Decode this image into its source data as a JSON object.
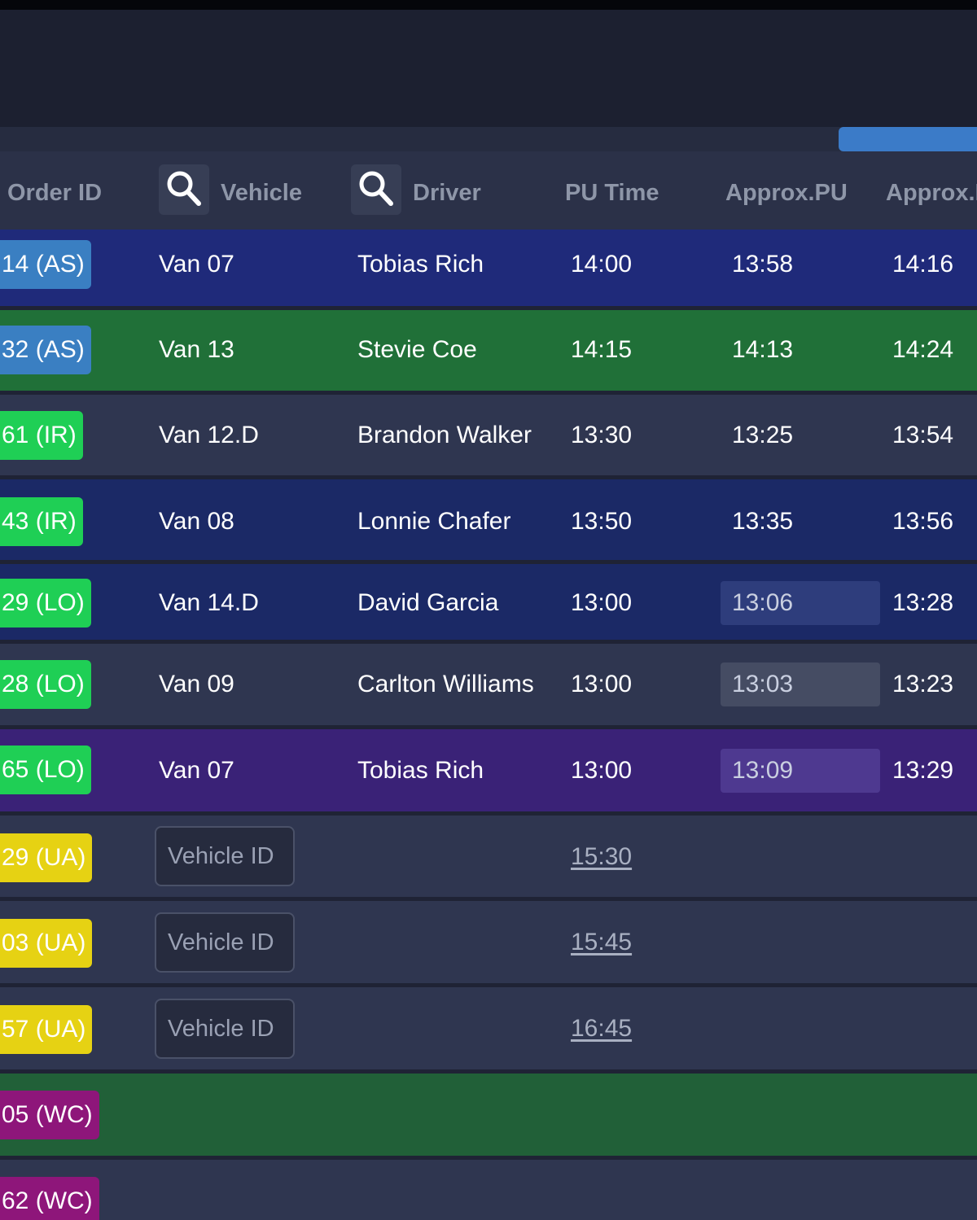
{
  "colors": {
    "row_navy": "#1f2a7a",
    "row_green": "#207038",
    "row_slate": "#2f3650",
    "row_darkblue": "#1b2966",
    "row_purple": "#3a2277",
    "badge_as": "#3a7fc2",
    "badge_ir": "#1fcf55",
    "badge_lo": "#1fcf55",
    "badge_ua": "#e6d213",
    "badge_wc": "#8e167a"
  },
  "header": {
    "order_id": "Order ID",
    "vehicle": "Vehicle",
    "driver": "Driver",
    "pu_time": "PU Time",
    "approx_pu": "Approx.PU",
    "approx_next": "Approx.I",
    "search_icon": "search-icon"
  },
  "rows": [
    {
      "order": "14 (AS)",
      "vehicle": "Van 07",
      "driver": "Tobias Rich",
      "pu_time": "14:00",
      "approx_pu": "13:58",
      "approx_next": "14:16"
    },
    {
      "order": "32 (AS)",
      "vehicle": "Van 13",
      "driver": "Stevie Coe",
      "pu_time": "14:15",
      "approx_pu": "14:13",
      "approx_next": "14:24"
    },
    {
      "order": "61 (IR)",
      "vehicle": "Van 12.D",
      "driver": "Brandon Walker",
      "pu_time": "13:30",
      "approx_pu": "13:25",
      "approx_next": "13:54"
    },
    {
      "order": "43 (IR)",
      "vehicle": "Van 08",
      "driver": "Lonnie Chafer",
      "pu_time": "13:50",
      "approx_pu": "13:35",
      "approx_next": "13:56"
    },
    {
      "order": "29 (LO)",
      "vehicle": "Van 14.D",
      "driver": "David Garcia",
      "pu_time": "13:00",
      "approx_pu": "13:06",
      "approx_next": "13:28"
    },
    {
      "order": "28 (LO)",
      "vehicle": "Van 09",
      "driver": "Carlton Williams",
      "pu_time": "13:00",
      "approx_pu": "13:03",
      "approx_next": "13:23"
    },
    {
      "order": "65 (LO)",
      "vehicle": "Van 07",
      "driver": "Tobias Rich",
      "pu_time": "13:00",
      "approx_pu": "13:09",
      "approx_next": "13:29"
    },
    {
      "order": "29 (UA)",
      "vehicle_placeholder": "Vehicle ID",
      "pu_time": "15:30"
    },
    {
      "order": "03 (UA)",
      "vehicle_placeholder": "Vehicle ID",
      "pu_time": "15:45"
    },
    {
      "order": "57 (UA)",
      "vehicle_placeholder": "Vehicle ID",
      "pu_time": "16:45"
    },
    {
      "order": "05 (WC)"
    },
    {
      "order": "62 (WC)"
    }
  ]
}
